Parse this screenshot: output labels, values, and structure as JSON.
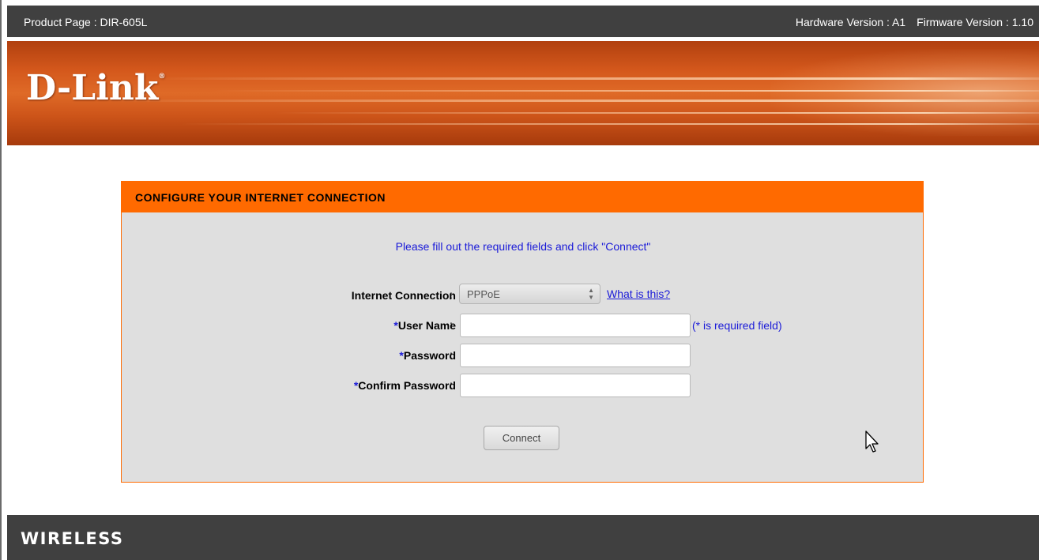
{
  "topbar": {
    "product": "Product Page : DIR-605L",
    "hardware": "Hardware Version : A1",
    "firmware": "Firmware Version : 1.10"
  },
  "banner": {
    "logo": "D-Link",
    "trademark": "®"
  },
  "panel": {
    "title": "CONFIGURE YOUR INTERNET CONNECTION",
    "instructions": "Please fill out the required fields and click \"Connect\"",
    "colon": ":",
    "required_mark": "*",
    "connection": {
      "label": "Internet Connection",
      "selected": "PPPoE",
      "help_link": "What is this?"
    },
    "username": {
      "label": "User Name",
      "value": "",
      "hint": "(* is required field)"
    },
    "password": {
      "label": "Password",
      "value": ""
    },
    "confirm_password": {
      "label": "Confirm Password",
      "value": ""
    },
    "connect_button": "Connect"
  },
  "footer": {
    "brand": "WIRELESS"
  },
  "colors": {
    "accent_orange": "#ff6a00",
    "dark_bar": "#404040",
    "link_blue": "#1a1ad8",
    "panel_bg": "#dfdfdf"
  }
}
